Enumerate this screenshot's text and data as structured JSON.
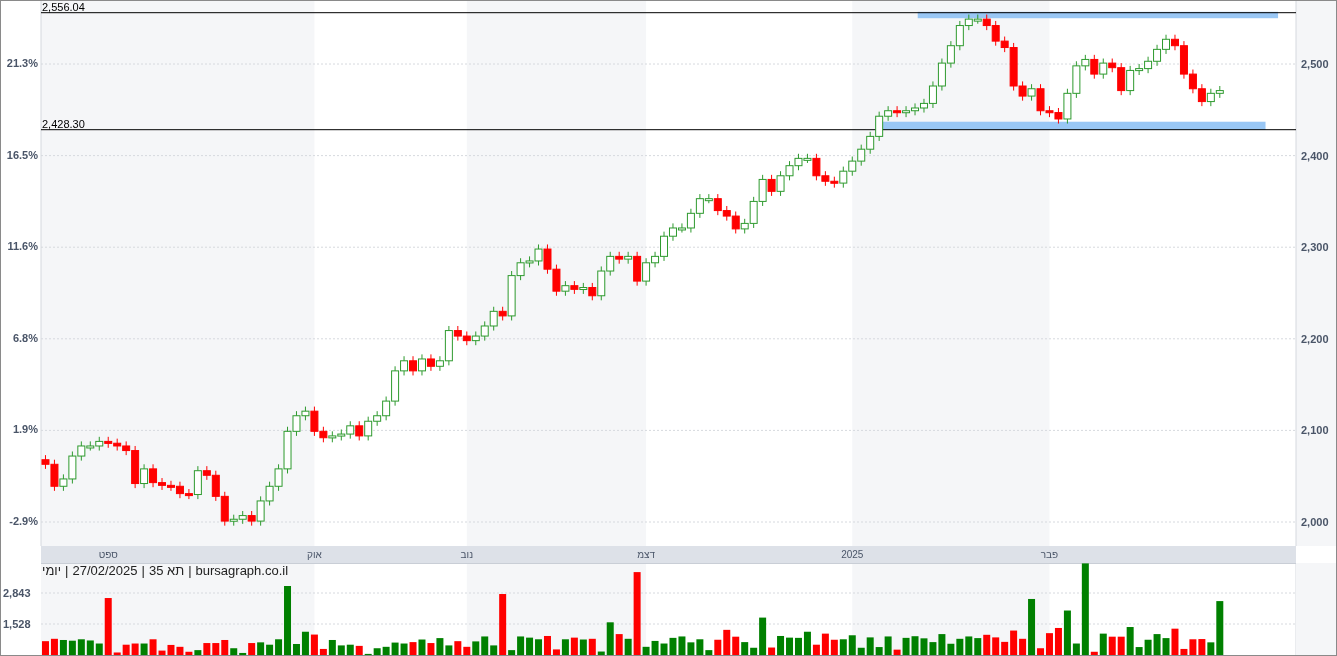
{
  "price_chart": {
    "percent_axis": [
      "21.3%",
      "16.5%",
      "11.6%",
      "6.8%",
      "1.9%",
      "-2.9%"
    ],
    "chart_data": {
      "type": "candlestick",
      "grid": true,
      "categories": [
        null,
        null,
        null,
        null,
        null,
        null,
        null,
        "ספט",
        null,
        null,
        null,
        null,
        null,
        null,
        null,
        null,
        null,
        null,
        null,
        null,
        null,
        null,
        null,
        null,
        null,
        null,
        null,
        null,
        null,
        null,
        "אוק",
        null,
        null,
        null,
        null,
        null,
        null,
        null,
        null,
        null,
        null,
        null,
        null,
        null,
        null,
        null,
        null,
        "נוב",
        null,
        null,
        null,
        null,
        null,
        null,
        null,
        null,
        null,
        null,
        null,
        null,
        null,
        null,
        null,
        null,
        null,
        null,
        null,
        "דצמ",
        null,
        null,
        null,
        null,
        null,
        null,
        null,
        null,
        null,
        null,
        null,
        null,
        null,
        null,
        null,
        null,
        null,
        null,
        null,
        null,
        null,
        null,
        "2025",
        null,
        null,
        null,
        null,
        null,
        null,
        null,
        null,
        null,
        null,
        null,
        null,
        null,
        null,
        null,
        null,
        null,
        null,
        null,
        null,
        null,
        "פבר",
        null,
        null,
        null,
        null,
        null,
        null,
        null,
        null,
        null,
        null,
        null,
        null,
        null,
        null,
        null,
        null,
        null,
        null,
        null,
        null,
        null,
        null,
        null,
        null,
        null,
        null,
        null
      ],
      "ohlc": [
        [
          2068,
          2073,
          2058,
          2063
        ],
        [
          2063,
          2068,
          2034,
          2039
        ],
        [
          2039,
          2052,
          2034,
          2047
        ],
        [
          2047,
          2077,
          2042,
          2072
        ],
        [
          2072,
          2088,
          2067,
          2083
        ],
        [
          2083,
          2088,
          2078,
          2083
        ],
        [
          2083,
          2093,
          2078,
          2088
        ],
        [
          2088,
          2093,
          2081,
          2086
        ],
        [
          2086,
          2091,
          2078,
          2083
        ],
        [
          2083,
          2088,
          2073,
          2078
        ],
        [
          2078,
          2083,
          2037,
          2042
        ],
        [
          2042,
          2063,
          2037,
          2058
        ],
        [
          2058,
          2063,
          2038,
          2043
        ],
        [
          2043,
          2048,
          2035,
          2040
        ],
        [
          2040,
          2045,
          2034,
          2039
        ],
        [
          2039,
          2044,
          2026,
          2031
        ],
        [
          2031,
          2036,
          2025,
          2030
        ],
        [
          2030,
          2061,
          2025,
          2056
        ],
        [
          2056,
          2061,
          2046,
          2051
        ],
        [
          2051,
          2056,
          2023,
          2028
        ],
        [
          2028,
          2033,
          1996,
          2001
        ],
        [
          2001,
          2008,
          1996,
          2003
        ],
        [
          2003,
          2012,
          1998,
          2007
        ],
        [
          2007,
          2012,
          1996,
          2001
        ],
        [
          2001,
          2028,
          1996,
          2023
        ],
        [
          2023,
          2044,
          2018,
          2039
        ],
        [
          2039,
          2063,
          2034,
          2058
        ],
        [
          2058,
          2104,
          2053,
          2099
        ],
        [
          2099,
          2121,
          2094,
          2116
        ],
        [
          2116,
          2126,
          2111,
          2121
        ],
        [
          2121,
          2126,
          2094,
          2099
        ],
        [
          2099,
          2104,
          2087,
          2092
        ],
        [
          2092,
          2099,
          2087,
          2094
        ],
        [
          2094,
          2101,
          2089,
          2096
        ],
        [
          2096,
          2110,
          2091,
          2105
        ],
        [
          2105,
          2110,
          2089,
          2094
        ],
        [
          2094,
          2115,
          2089,
          2110
        ],
        [
          2110,
          2121,
          2105,
          2116
        ],
        [
          2116,
          2137,
          2111,
          2132
        ],
        [
          2132,
          2170,
          2127,
          2165
        ],
        [
          2165,
          2181,
          2160,
          2176
        ],
        [
          2176,
          2181,
          2160,
          2165
        ],
        [
          2165,
          2183,
          2160,
          2178
        ],
        [
          2178,
          2183,
          2165,
          2170
        ],
        [
          2170,
          2181,
          2165,
          2176
        ],
        [
          2176,
          2214,
          2171,
          2209
        ],
        [
          2209,
          2214,
          2198,
          2203
        ],
        [
          2203,
          2208,
          2193,
          2198
        ],
        [
          2198,
          2208,
          2193,
          2203
        ],
        [
          2203,
          2219,
          2198,
          2214
        ],
        [
          2214,
          2235,
          2209,
          2230
        ],
        [
          2230,
          2235,
          2220,
          2225
        ],
        [
          2225,
          2274,
          2220,
          2269
        ],
        [
          2269,
          2288,
          2264,
          2283
        ],
        [
          2283,
          2290,
          2278,
          2285
        ],
        [
          2285,
          2303,
          2280,
          2298
        ],
        [
          2298,
          2303,
          2271,
          2276
        ],
        [
          2276,
          2281,
          2247,
          2252
        ],
        [
          2252,
          2263,
          2247,
          2258
        ],
        [
          2258,
          2263,
          2249,
          2254
        ],
        [
          2254,
          2261,
          2249,
          2256
        ],
        [
          2256,
          2261,
          2242,
          2247
        ],
        [
          2247,
          2279,
          2242,
          2274
        ],
        [
          2274,
          2295,
          2269,
          2290
        ],
        [
          2290,
          2295,
          2282,
          2287
        ],
        [
          2287,
          2295,
          2282,
          2290
        ],
        [
          2290,
          2295,
          2258,
          2263
        ],
        [
          2263,
          2288,
          2258,
          2283
        ],
        [
          2283,
          2295,
          2278,
          2290
        ],
        [
          2290,
          2317,
          2285,
          2312
        ],
        [
          2312,
          2326,
          2307,
          2321
        ],
        [
          2321,
          2326,
          2316,
          2321
        ],
        [
          2321,
          2342,
          2316,
          2337
        ],
        [
          2337,
          2358,
          2332,
          2353
        ],
        [
          2353,
          2358,
          2348,
          2353
        ],
        [
          2353,
          2358,
          2335,
          2340
        ],
        [
          2340,
          2345,
          2329,
          2334
        ],
        [
          2334,
          2339,
          2315,
          2320
        ],
        [
          2320,
          2331,
          2315,
          2326
        ],
        [
          2326,
          2355,
          2321,
          2350
        ],
        [
          2350,
          2379,
          2345,
          2374
        ],
        [
          2374,
          2379,
          2356,
          2361
        ],
        [
          2361,
          2383,
          2356,
          2378
        ],
        [
          2378,
          2394,
          2373,
          2389
        ],
        [
          2389,
          2402,
          2384,
          2397
        ],
        [
          2397,
          2402,
          2392,
          2397
        ],
        [
          2397,
          2402,
          2373,
          2378
        ],
        [
          2378,
          2383,
          2367,
          2372
        ],
        [
          2372,
          2377,
          2365,
          2370
        ],
        [
          2370,
          2388,
          2365,
          2383
        ],
        [
          2383,
          2399,
          2378,
          2394
        ],
        [
          2394,
          2412,
          2389,
          2407
        ],
        [
          2407,
          2426,
          2402,
          2421
        ],
        [
          2421,
          2448,
          2416,
          2443
        ],
        [
          2443,
          2454,
          2438,
          2449
        ],
        [
          2449,
          2454,
          2442,
          2447
        ],
        [
          2447,
          2454,
          2442,
          2449
        ],
        [
          2449,
          2457,
          2444,
          2452
        ],
        [
          2452,
          2462,
          2447,
          2457
        ],
        [
          2457,
          2481,
          2452,
          2476
        ],
        [
          2476,
          2506,
          2471,
          2501
        ],
        [
          2501,
          2525,
          2496,
          2520
        ],
        [
          2520,
          2547,
          2515,
          2542
        ],
        [
          2542,
          2554,
          2537,
          2549
        ],
        [
          2549,
          2554,
          2544,
          2549
        ],
        [
          2549,
          2554,
          2537,
          2542
        ],
        [
          2542,
          2547,
          2520,
          2525
        ],
        [
          2525,
          2530,
          2513,
          2518
        ],
        [
          2518,
          2523,
          2471,
          2476
        ],
        [
          2476,
          2481,
          2460,
          2465
        ],
        [
          2465,
          2478,
          2460,
          2473
        ],
        [
          2473,
          2478,
          2444,
          2449
        ],
        [
          2449,
          2454,
          2442,
          2447
        ],
        [
          2447,
          2452,
          2435,
          2440
        ],
        [
          2440,
          2473,
          2435,
          2468
        ],
        [
          2468,
          2503,
          2463,
          2498
        ],
        [
          2498,
          2510,
          2493,
          2505
        ],
        [
          2505,
          2510,
          2484,
          2489
        ],
        [
          2489,
          2506,
          2484,
          2501
        ],
        [
          2501,
          2506,
          2491,
          2496
        ],
        [
          2496,
          2501,
          2466,
          2471
        ],
        [
          2471,
          2498,
          2466,
          2493
        ],
        [
          2493,
          2500,
          2488,
          2495
        ],
        [
          2495,
          2508,
          2490,
          2503
        ],
        [
          2503,
          2521,
          2498,
          2516
        ],
        [
          2516,
          2532,
          2511,
          2527
        ],
        [
          2527,
          2532,
          2515,
          2520
        ],
        [
          2520,
          2525,
          2484,
          2489
        ],
        [
          2489,
          2494,
          2468,
          2473
        ],
        [
          2473,
          2478,
          2454,
          2459
        ],
        [
          2459,
          2473,
          2454,
          2468
        ],
        [
          2468,
          2476,
          2463,
          2471
        ],
        null,
        null,
        null,
        null,
        null,
        null,
        null,
        null
      ],
      "ylim": [
        1973.8,
        2568.8
      ],
      "yticks": [
        {
          "value": 2000,
          "label": "2,000"
        },
        {
          "value": 2100,
          "label": "2,100"
        },
        {
          "value": 2200,
          "label": "2,200"
        },
        {
          "value": 2300,
          "label": "2,300"
        },
        {
          "value": 2400,
          "label": "2,400"
        },
        {
          "value": 2500,
          "label": "2,500"
        }
      ],
      "ref_lines": [
        {
          "axis": "y",
          "value": 2556.04,
          "label": "2,556.04"
        },
        {
          "axis": "y",
          "value": 2428.3,
          "label": "2,428.30"
        }
      ],
      "bands": [
        {
          "axis": "y",
          "from": 2550,
          "to": 2557,
          "color": "#99c7f5"
        },
        {
          "axis": "y",
          "from": 2428,
          "to": 2437,
          "color": "#99c7f5"
        }
      ]
    }
  },
  "info_line": [
    "יומי",
    "|",
    "27/02/2025",
    "|",
    "תא 35",
    "|",
    "bursagraph.co.il"
  ],
  "volume_chart": {
    "chart_data": {
      "type": "bar",
      "grid": true,
      "values": [
        800,
        900,
        850,
        820,
        880,
        830,
        700,
        2630,
        320,
        650,
        700,
        700,
        880,
        400,
        640,
        560,
        350,
        420,
        720,
        720,
        850,
        500,
        300,
        720,
        750,
        650,
        880,
        3140,
        680,
        1200,
        1080,
        470,
        850,
        620,
        650,
        600,
        260,
        500,
        560,
        740,
        700,
        760,
        870,
        720,
        930,
        620,
        800,
        560,
        790,
        1000,
        620,
        2800,
        420,
        1000,
        950,
        880,
        1020,
        450,
        880,
        950,
        870,
        900,
        360,
        1600,
        1100,
        900,
        3730,
        560,
        810,
        700,
        940,
        1000,
        750,
        880,
        420,
        860,
        1280,
        990,
        760,
        520,
        1800,
        530,
        1020,
        950,
        940,
        1200,
        650,
        1120,
        860,
        880,
        1050,
        520,
        960,
        550,
        1000,
        440,
        940,
        1010,
        920,
        760,
        1100,
        690,
        900,
        1000,
        930,
        1070,
        960,
        770,
        1250,
        900,
        2590,
        500,
        1140,
        1360,
        2100,
        700,
        4100,
        350,
        1120,
        990,
        990,
        1400,
        550,
        860,
        1100,
        930,
        1330,
        470,
        880,
        890,
        750,
        2500,
        null,
        null,
        null,
        null,
        null,
        null,
        null,
        null
      ],
      "categories": [
        null,
        null,
        null,
        null,
        null,
        null,
        null,
        null,
        null,
        null,
        null,
        null,
        null,
        null,
        null,
        null,
        null,
        null,
        null,
        null,
        null,
        null,
        null,
        null,
        null,
        null,
        null,
        null,
        null,
        null,
        null,
        null,
        null,
        null,
        null,
        null,
        null,
        null,
        null,
        null,
        null,
        null,
        null,
        null,
        null,
        null,
        null,
        null,
        null,
        null,
        null,
        null,
        null,
        null,
        null,
        null,
        null,
        null,
        null,
        null,
        null,
        null,
        null,
        null,
        null,
        null,
        null,
        null,
        null,
        null,
        null,
        null,
        null,
        null,
        null,
        null,
        null,
        null,
        null,
        null,
        null,
        null,
        null,
        null,
        null,
        null,
        null,
        null,
        null,
        null,
        null,
        null,
        null,
        null,
        null,
        null,
        null,
        null,
        null,
        null,
        null,
        null,
        null,
        null,
        null,
        null,
        null,
        null,
        null,
        null,
        null,
        null,
        null,
        null,
        null,
        null,
        null,
        null,
        null,
        null,
        null,
        null,
        null,
        null,
        null,
        null,
        null,
        null,
        null,
        null,
        null,
        null,
        null,
        null,
        null,
        null,
        null,
        null,
        null,
        null
      ],
      "ylim": [
        213,
        4116
      ],
      "yticks": [
        {
          "value": 1528,
          "label": "1,528"
        },
        {
          "value": 2843,
          "label": "2,843"
        }
      ]
    }
  }
}
